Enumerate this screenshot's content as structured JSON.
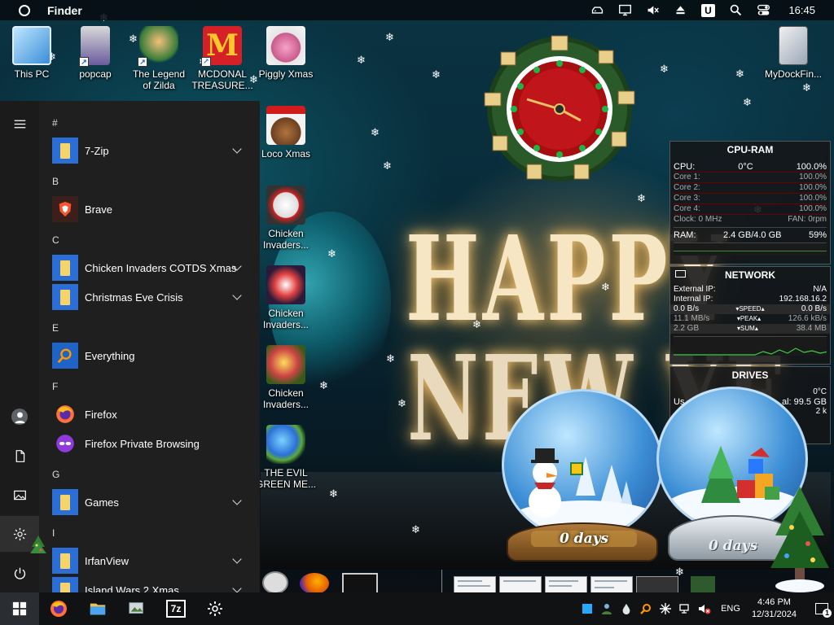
{
  "topbar": {
    "app_name": "Finder",
    "clock": "16:45",
    "user_badge": "U"
  },
  "desktop_icons": [
    {
      "label": "This PC"
    },
    {
      "label": "popcap"
    },
    {
      "label": "The Legend of Zilda"
    },
    {
      "label": "MCDONAL TREASURE..."
    },
    {
      "label": "Piggly Xmas"
    },
    {
      "label": "MyDockFin..."
    },
    {
      "label": "Loco Xmas"
    },
    {
      "label": "Chicken Invaders..."
    },
    {
      "label": "Chicken Invaders..."
    },
    {
      "label": "Chicken Invaders..."
    },
    {
      "label": "THE EVIL GREEN ME..."
    }
  ],
  "greeting": {
    "line1": "HAPPY",
    "line2": "NEW YE"
  },
  "cpu_ram": {
    "title": "CPU-RAM",
    "cpu_label": "CPU:",
    "cpu_temp": "0°C",
    "cpu_pct": "100.0%",
    "cores": [
      {
        "label": "Core 1:",
        "value": "100.0%"
      },
      {
        "label": "Core 2:",
        "value": "100.0%"
      },
      {
        "label": "Core 3:",
        "value": "100.0%"
      },
      {
        "label": "Core 4:",
        "value": "100.0%"
      }
    ],
    "clock": "Clock: 0 MHz",
    "fan": "FAN: 0rpm",
    "ram_label": "RAM:",
    "ram_value": "2.4 GB/4.0 GB",
    "ram_pct": "59%"
  },
  "network": {
    "title": "NETWORK",
    "external_label": "External IP:",
    "external_value": "N/A",
    "internal_label": "Internal IP:",
    "internal_value": "192.168.16.2",
    "speed_left": "0.0 B/s",
    "speed_label": "SPEED",
    "speed_right": "0.0 B/s",
    "peak_left": "11.1 MB/s",
    "peak_label": "PEAK",
    "peak_right": "126.6 kB/s",
    "sum_left": "2.2 GB",
    "sum_label": "SUM",
    "sum_right": "38.4 MB"
  },
  "drives": {
    "title": "DRIVES",
    "temp": "0°C",
    "used_label": "Us",
    "total_label": "al:",
    "total_value": "99.5 GB",
    "extra": "2 k"
  },
  "globes": [
    {
      "label": "0 days"
    },
    {
      "label": "0 days"
    }
  ],
  "start_menu": {
    "sections": [
      {
        "letter": "#",
        "apps": [
          {
            "label": "7-Zip",
            "icon": "folder-icon",
            "expandable": true
          }
        ]
      },
      {
        "letter": "B",
        "apps": [
          {
            "label": "Brave",
            "icon": "brave-icon",
            "expandable": false
          }
        ]
      },
      {
        "letter": "C",
        "apps": [
          {
            "label": "Chicken Invaders COTDS Xmas",
            "icon": "folder-icon",
            "expandable": true
          },
          {
            "label": "Christmas Eve Crisis",
            "icon": "folder-icon",
            "expandable": true
          }
        ]
      },
      {
        "letter": "E",
        "apps": [
          {
            "label": "Everything",
            "icon": "search-app-icon",
            "expandable": false
          }
        ]
      },
      {
        "letter": "F",
        "apps": [
          {
            "label": "Firefox",
            "icon": "firefox-icon",
            "expandable": false
          },
          {
            "label": "Firefox Private Browsing",
            "icon": "firefox-private-icon",
            "expandable": false
          }
        ]
      },
      {
        "letter": "G",
        "apps": [
          {
            "label": "Games",
            "icon": "folder-icon",
            "expandable": true
          }
        ]
      },
      {
        "letter": "I",
        "apps": [
          {
            "label": "IrfanView",
            "icon": "folder-icon",
            "expandable": true
          },
          {
            "label": "Island Wars 2 Xmas",
            "icon": "folder-icon",
            "expandable": true
          }
        ]
      }
    ]
  },
  "taskbar": {
    "language": "ENG",
    "time": "4:46 PM",
    "date": "12/31/2024",
    "notification_count": "1",
    "zip_label": "7z"
  },
  "colors": {
    "accent_blue": "#2b6fd6",
    "start_bg": "#1f1f1f",
    "taskbar_bg": "#101214"
  }
}
